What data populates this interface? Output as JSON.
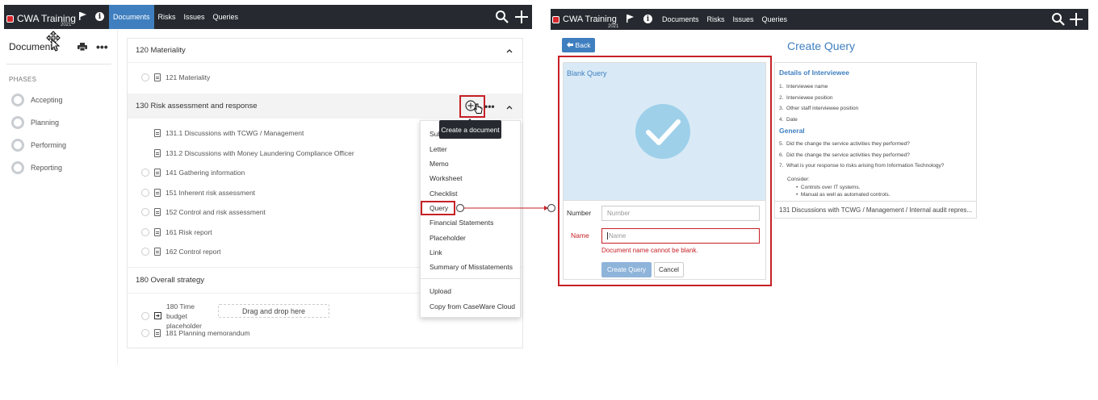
{
  "left_app": {
    "app_title": "CWA Training",
    "year": "2021",
    "nav": [
      "Documents",
      "Risks",
      "Issues",
      "Queries"
    ],
    "panel_title": "Documents",
    "phases_label": "PHASES",
    "phases": [
      "Accepting",
      "Planning",
      "Performing",
      "Reporting"
    ],
    "sections": [
      {
        "title": "120 Materiality",
        "docs": [
          "121 Materiality"
        ]
      },
      {
        "title": "130 Risk assessment and response",
        "docs": [
          "131.1 Discussions with TCWG / Management",
          "131.2 Discussions with Money Laundering Compliance Officer",
          "141 Gathering information",
          "151 Inherent risk assessment",
          "152 Control and risk assessment",
          "161 Risk report",
          "162 Control report"
        ]
      },
      {
        "title": "180 Overall strategy",
        "docs": [
          "180 Time budget placeholder",
          "181 Planning memorandum"
        ]
      }
    ],
    "drag_drop": "Drag and drop here",
    "tooltip": "Create a document",
    "menu_partial": "Sub",
    "menu_items": [
      "Letter",
      "Memo",
      "Worksheet",
      "Checklist",
      "Query",
      "Financial Statements",
      "Placeholder",
      "Link",
      "Summary of Misstatements",
      "Upload",
      "Copy from CaseWare Cloud"
    ]
  },
  "right_app": {
    "app_title": "CWA Training",
    "year": "2021",
    "nav": [
      "Documents",
      "Risks",
      "Issues",
      "Queries"
    ],
    "back_label": "Back",
    "page_title": "Create Query",
    "blank_query": "Blank Query",
    "number_label": "Number",
    "number_placeholder": "Number",
    "name_label": "Name",
    "name_placeholder": "Name",
    "error": "Document name cannot be blank.",
    "create_btn": "Create Query",
    "cancel_btn": "Cancel",
    "preview": {
      "heading1": "Details of Interviewee",
      "items1": [
        "Interviewee name",
        "Interviewee position",
        "Other staff interviewee position",
        "Date"
      ],
      "heading2": "General",
      "items2": [
        "Did the change the service activities they performed?",
        "Did the change the service activities they performed?",
        "What is your response to risks arising from Information Technology?"
      ],
      "consider": "Consider:",
      "bullets": [
        "Controls over IT systems.",
        "Manual as well as automated controls."
      ],
      "footer": "131 Discussions with TCWG / Management / Internal audit repres..."
    }
  },
  "colors": {
    "navbar": "#262a30",
    "accent": "#3f7fc0",
    "highlight": "#c62026",
    "check": "#9ed0ea"
  }
}
